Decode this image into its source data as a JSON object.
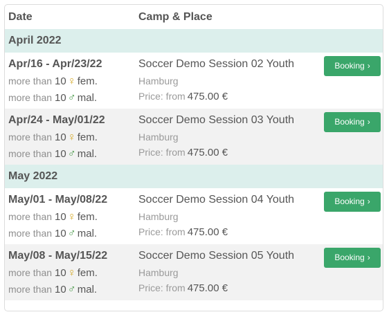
{
  "header": {
    "date_label": "Date",
    "camp_label": "Camp & Place"
  },
  "months": [
    {
      "label": "April 2022",
      "rows": [
        {
          "dates": "Apr/16 - Apr/23/22",
          "female": {
            "prefix": "more than",
            "count": "10",
            "symbol": "♀",
            "unit": "fem."
          },
          "male": {
            "prefix": "more than",
            "count": "10",
            "symbol": "♂",
            "unit": "mal."
          },
          "title": "Soccer Demo Session 02 Youth",
          "place": "Hamburg",
          "price_prefix": "Price: from",
          "price": "475.00 €",
          "button": "Booking",
          "chevron": "›"
        },
        {
          "dates": "Apr/24 - May/01/22",
          "female": {
            "prefix": "more than",
            "count": "10",
            "symbol": "♀",
            "unit": "fem."
          },
          "male": {
            "prefix": "more than",
            "count": "10",
            "symbol": "♂",
            "unit": "mal."
          },
          "title": "Soccer Demo Session 03 Youth",
          "place": "Hamburg",
          "price_prefix": "Price: from",
          "price": "475.00 €",
          "button": "Booking",
          "chevron": "›"
        }
      ]
    },
    {
      "label": "May 2022",
      "rows": [
        {
          "dates": "May/01 - May/08/22",
          "female": {
            "prefix": "more than",
            "count": "10",
            "symbol": "♀",
            "unit": "fem."
          },
          "male": {
            "prefix": "more than",
            "count": "10",
            "symbol": "♂",
            "unit": "mal."
          },
          "title": "Soccer Demo Session 04 Youth",
          "place": "Hamburg",
          "price_prefix": "Price: from",
          "price": "475.00 €",
          "button": "Booking",
          "chevron": "›"
        },
        {
          "dates": "May/08 - May/15/22",
          "female": {
            "prefix": "more than",
            "count": "10",
            "symbol": "♀",
            "unit": "fem."
          },
          "male": {
            "prefix": "more than",
            "count": "10",
            "symbol": "♂",
            "unit": "mal."
          },
          "title": "Soccer Demo Session 05 Youth",
          "place": "Hamburg",
          "price_prefix": "Price: from",
          "price": "475.00 €",
          "button": "Booking",
          "chevron": "›"
        }
      ]
    }
  ],
  "colors": {
    "month_bg": "#dcefec",
    "row_alt_bg": "#f2f2f2",
    "button_bg": "#3aa66a",
    "female_symbol": "#d5aa2a",
    "male_symbol": "#4a9a4a"
  },
  "icons": {
    "female": "female-symbol-icon",
    "male": "male-symbol-icon",
    "chevron": "chevron-right-icon"
  }
}
